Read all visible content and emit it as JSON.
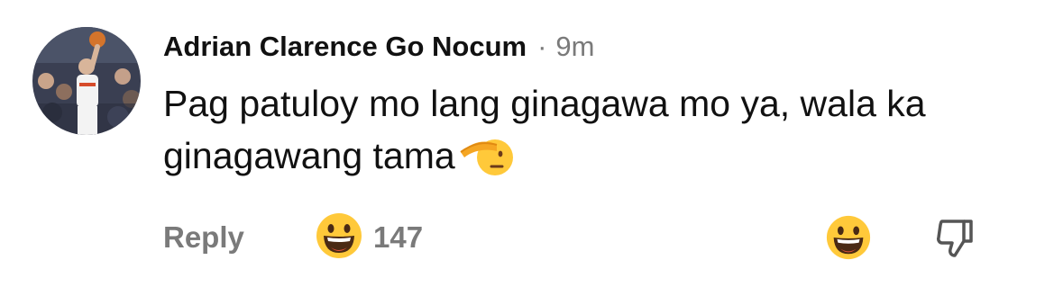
{
  "comment": {
    "author": "Adrian Clarence Go Nocum",
    "separator": "·",
    "time": "9m",
    "text": "Pag patuloy mo lang ginagawa mo ya, wala ka ginagawang tama",
    "inline_emoji": "saluting-face-icon",
    "avatar_description": "profile photo",
    "reply_label": "Reply",
    "reaction_icon": "grinning-face-icon",
    "reaction_count": "147",
    "react_button_icon": "grinning-face-icon",
    "dislike_icon": "thumbs-down-icon",
    "colors": {
      "text": "#111111",
      "muted": "#7a7a7a",
      "emoji_yellow": "#ffc93a"
    }
  }
}
